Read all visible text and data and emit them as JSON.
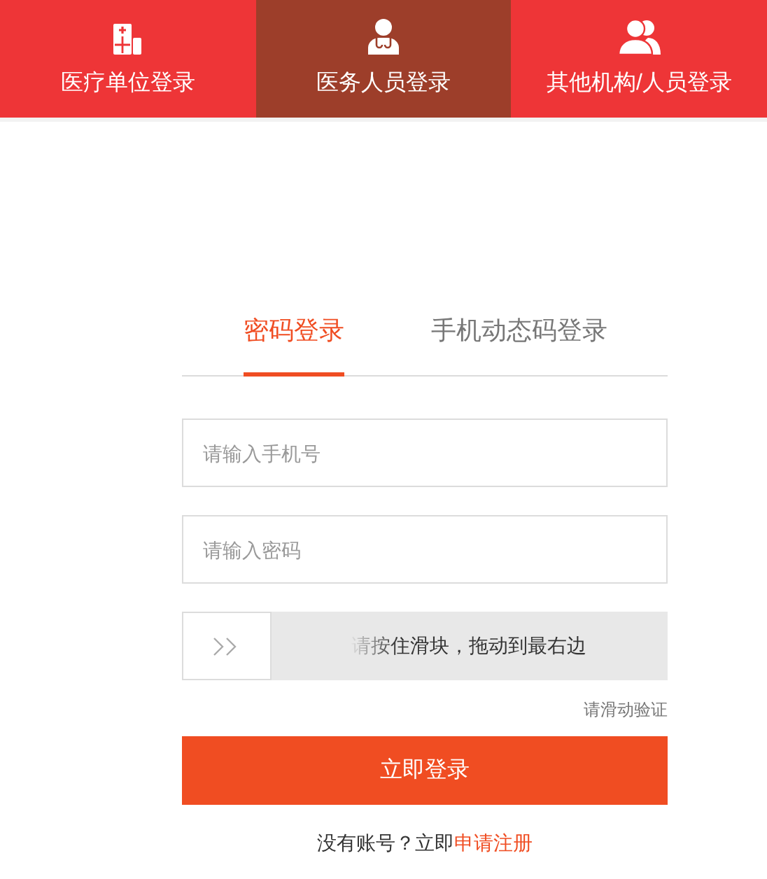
{
  "top_tabs": [
    {
      "label": "医疗单位登录",
      "kind": "hospital",
      "selected": false
    },
    {
      "label": "医务人员登录",
      "kind": "doctor",
      "selected": true
    },
    {
      "label": "其他机构/人员登录",
      "kind": "people",
      "selected": false
    }
  ],
  "login_tabs": [
    {
      "label": "密码登录",
      "selected": true
    },
    {
      "label": "手机动态码登录",
      "selected": false
    }
  ],
  "fields": [
    {
      "placeholder": "请输入手机号"
    },
    {
      "placeholder": "请输入密码"
    }
  ],
  "slider": {
    "text": "请按住滑块，拖动到最右边",
    "level": 0,
    "hint": "请滑动验证"
  },
  "submit": "立即登录",
  "register": {
    "text": "没有账号？立即",
    "link": "申请注册"
  }
}
